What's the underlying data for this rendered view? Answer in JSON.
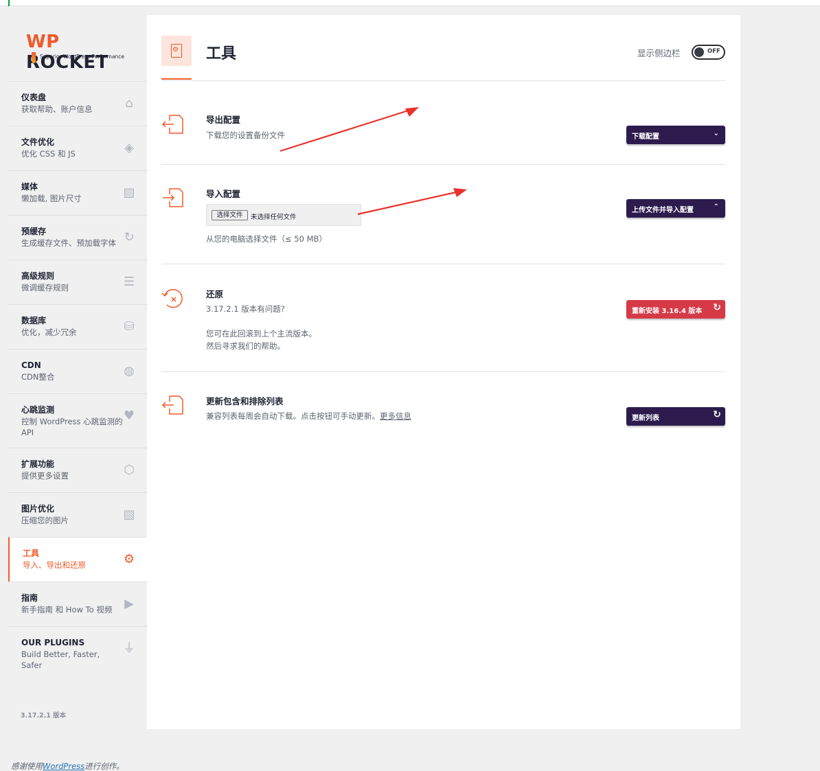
{
  "logo": {
    "brand_wp": "WP",
    "brand_rocket": "ROCKET",
    "tagline": "Superior WordPress Performance"
  },
  "sidebar": {
    "items": [
      {
        "title": "仪表盘",
        "subtitle": "获取帮助、账户信息",
        "icon": "home-icon"
      },
      {
        "title": "文件优化",
        "subtitle": "优化 CSS 和 JS",
        "icon": "layers-icon"
      },
      {
        "title": "媒体",
        "subtitle": "懒加载, 图片尺寸",
        "icon": "image-icon"
      },
      {
        "title": "预缓存",
        "subtitle": "生成缓存文件、预加载字体",
        "icon": "refresh-icon"
      },
      {
        "title": "高级规则",
        "subtitle": "微调缓存规则",
        "icon": "list-icon"
      },
      {
        "title": "数据库",
        "subtitle": "优化，减少冗余",
        "icon": "database-icon"
      },
      {
        "title": "CDN",
        "subtitle": "CDN整合",
        "icon": "globe-hand-icon"
      },
      {
        "title": "心跳监测",
        "subtitle": "控制 WordPress 心跳监测的 API",
        "icon": "heartbeat-icon"
      },
      {
        "title": "扩展功能",
        "subtitle": "提供更多设置",
        "icon": "cubes-icon"
      },
      {
        "title": "图片优化",
        "subtitle": "压缩您的图片",
        "icon": "images-icon"
      },
      {
        "title": "工具",
        "subtitle": "导入、导出和还原",
        "icon": "tools-doc-icon"
      },
      {
        "title": "指南",
        "subtitle": "新手指南 和 How To 视频",
        "icon": "video-icon"
      },
      {
        "title": "OUR PLUGINS",
        "subtitle": "Build Better, Faster, Safer",
        "icon": "plug-icon"
      }
    ],
    "version": "3.17.2.1 版本"
  },
  "header": {
    "title": "工具",
    "sidebar_toggle_label": "显示侧边栏",
    "toggle_state": "OFF"
  },
  "sections": {
    "export": {
      "title": "导出配置",
      "desc": "下载您的设置备份文件",
      "button": "下载配置"
    },
    "import": {
      "title": "导入配置",
      "file_button": "选择文件",
      "file_status": "未选择任何文件",
      "hint": "从您的电脑选择文件（≤ 50 MB）",
      "button": "上传文件并导入配置"
    },
    "restore": {
      "title": "还原",
      "line1": "3.17.2.1 版本有问题?",
      "line2": "您可在此回滚到上个主流版本。",
      "line3": "然后寻求我们的帮助。",
      "button": "重新安装 3.16.4 版本"
    },
    "update": {
      "title": "更新包含和排除列表",
      "desc": "兼容列表每周会自动下载。点击按钮可手动更新。",
      "link": "更多信息",
      "button": "更新列表"
    }
  },
  "footer": {
    "prefix": "感谢使用",
    "link": "WordPress",
    "suffix": "进行创作。"
  },
  "colors": {
    "accent": "#f05a28",
    "button": "#2d1b4e",
    "danger": "#d63a47"
  }
}
